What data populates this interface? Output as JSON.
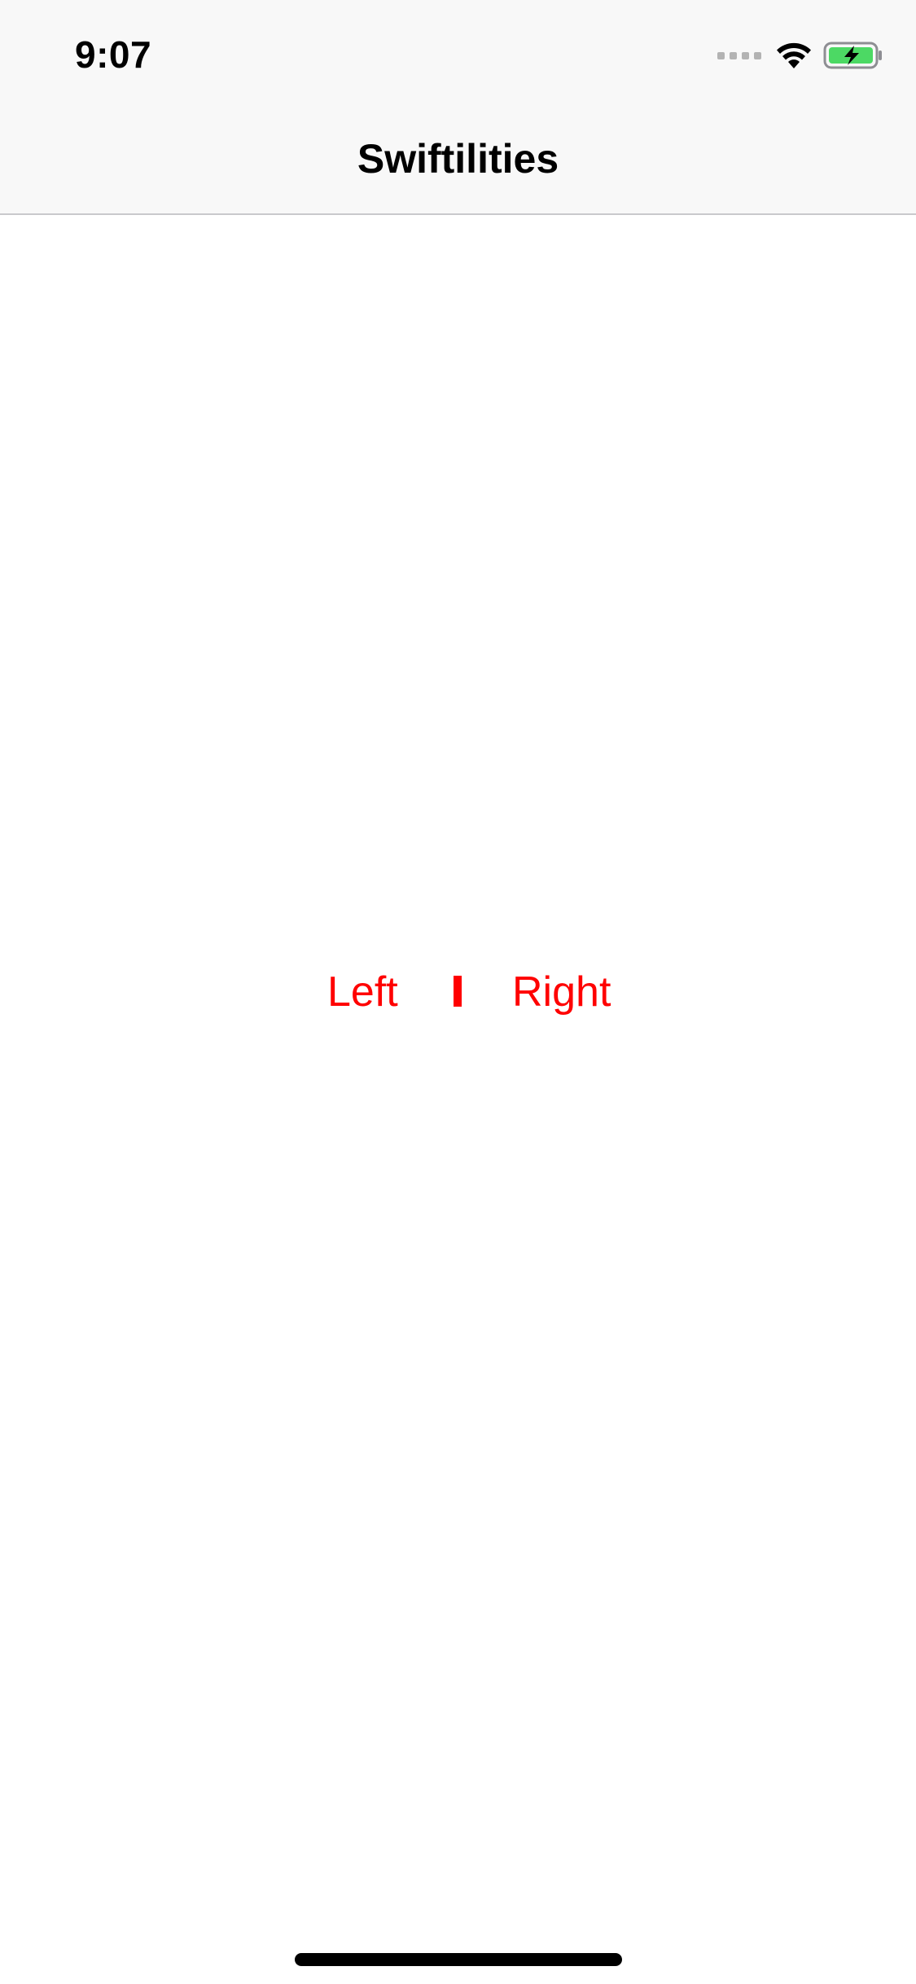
{
  "status_bar": {
    "time": "9:07",
    "icons": [
      "signal-dots-icon",
      "wifi-icon",
      "battery-charging-icon"
    ],
    "battery_color": "#4cd964"
  },
  "nav_bar": {
    "title": "Swiftilities"
  },
  "segmented": {
    "left_label": "Left",
    "right_label": "Right",
    "tint_color": "#ff0000"
  }
}
